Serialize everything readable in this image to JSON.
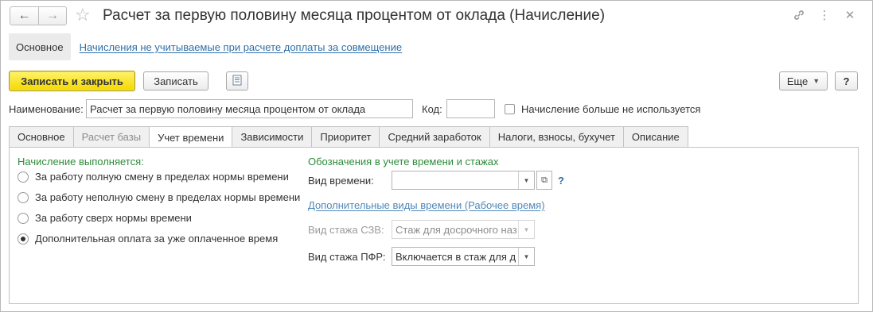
{
  "window": {
    "title": "Расчет за первую половину месяца процентом от оклада (Начисление)"
  },
  "nav": {
    "back_icon": "arrow-left",
    "forward_icon": "arrow-right",
    "favorite_icon": "star"
  },
  "title_icons": {
    "link": "link-icon",
    "more": "more-vertical-icon",
    "close": "close-icon"
  },
  "panel": {
    "active": "Основное",
    "link": "Начисления не учитываемые при расчете доплаты за совмещение"
  },
  "toolbar": {
    "save_close": "Записать и закрыть",
    "save": "Записать",
    "more": "Еще",
    "help": "?"
  },
  "header_fields": {
    "name_label": "Наименование:",
    "name_value": "Расчет за первую половину месяца процентом от оклада",
    "code_label": "Код:",
    "code_value": "",
    "not_used_label": "Начисление больше не используется"
  },
  "tabs": [
    {
      "label": "Основное",
      "state": "normal"
    },
    {
      "label": "Расчет базы",
      "state": "disabled"
    },
    {
      "label": "Учет времени",
      "state": "active"
    },
    {
      "label": "Зависимости",
      "state": "normal"
    },
    {
      "label": "Приоритет",
      "state": "normal"
    },
    {
      "label": "Средний заработок",
      "state": "normal"
    },
    {
      "label": "Налоги, взносы, бухучет",
      "state": "normal"
    },
    {
      "label": "Описание",
      "state": "normal"
    }
  ],
  "time_tab": {
    "accrual_title": "Начисление выполняется:",
    "options": [
      {
        "label": "За работу полную смену в пределах нормы времени",
        "checked": false
      },
      {
        "label": "За работу неполную смену в пределах нормы времени",
        "checked": false
      },
      {
        "label": "За работу сверх нормы времени",
        "checked": false
      },
      {
        "label": "Дополнительная оплата за уже оплаченное время",
        "checked": true
      }
    ],
    "designations_title": "Обозначения в учете времени и стажах",
    "time_kind_label": "Вид времени:",
    "time_kind_value": "",
    "help": "?",
    "additional_link": "Дополнительные виды времени (Рабочее время)",
    "szv_label": "Вид стажа СЗВ:",
    "szv_value": "Стаж для досрочного наз",
    "pfr_label": "Вид стажа ПФР:",
    "pfr_value": "Включается в стаж для д"
  },
  "colors": {
    "primary_button": "#f4d800",
    "group_title": "#2e8b3a",
    "link": "#2f6fa9"
  }
}
